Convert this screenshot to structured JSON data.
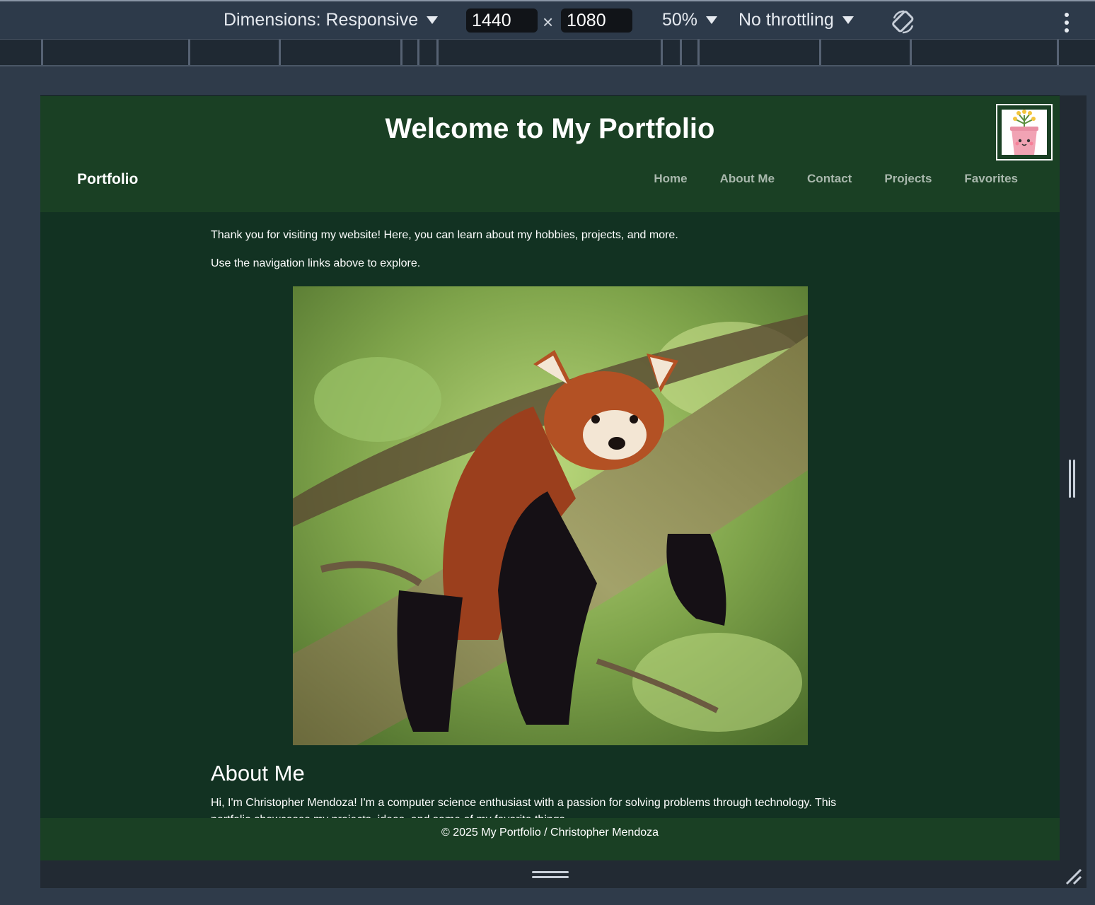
{
  "devtools": {
    "dimensions_label": "Dimensions: Responsive",
    "width_value": "1440",
    "height_value": "1080",
    "zoom": "50%",
    "throttling": "No throttling"
  },
  "site": {
    "title": "Welcome to My Portfolio",
    "brand": "Portfolio",
    "nav": [
      "Home",
      "About Me",
      "Contact",
      "Projects",
      "Favorites"
    ],
    "intro_1": "Thank you for visiting my website! Here, you can learn about my hobbies, projects, and more.",
    "intro_2": "Use the navigation links above to explore.",
    "about_heading": "About Me",
    "about_text": "Hi, I'm Christopher Mendoza! I'm a computer science enthusiast with a passion for solving problems through technology. This portfolio showcases my projects, ideas, and some of my favorite things.",
    "footer": "© 2025 My Portfolio / Christopher Mendoza"
  },
  "colors": {
    "header_bg": "#1a4024",
    "page_bg": "#123222",
    "nav_link": "#a9b8ad"
  }
}
